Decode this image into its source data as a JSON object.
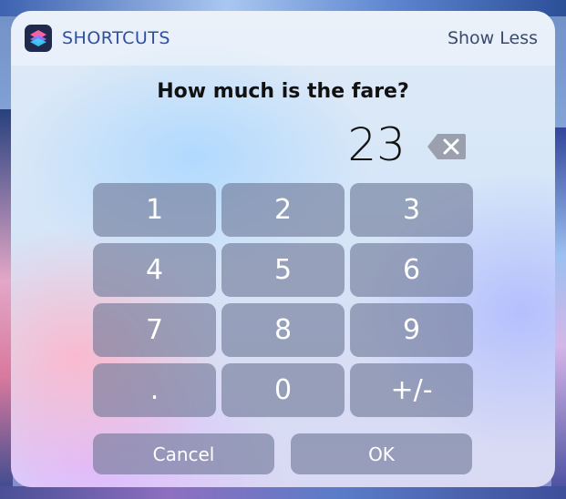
{
  "header": {
    "app_icon": "shortcuts-icon",
    "app_name": "SHORTCUTS",
    "show_less_label": "Show Less"
  },
  "prompt": {
    "question": "How much is the fare?",
    "value": "23",
    "delete_icon": "backspace-icon"
  },
  "keypad": {
    "keys": [
      "1",
      "2",
      "3",
      "4",
      "5",
      "6",
      "7",
      "8",
      "9",
      ".",
      "0",
      "+/-"
    ]
  },
  "actions": {
    "cancel_label": "Cancel",
    "ok_label": "OK"
  },
  "colors": {
    "app_name": "#2f4fa0",
    "key_background": "#6e7896",
    "icon_background": "#1f2a4c"
  }
}
